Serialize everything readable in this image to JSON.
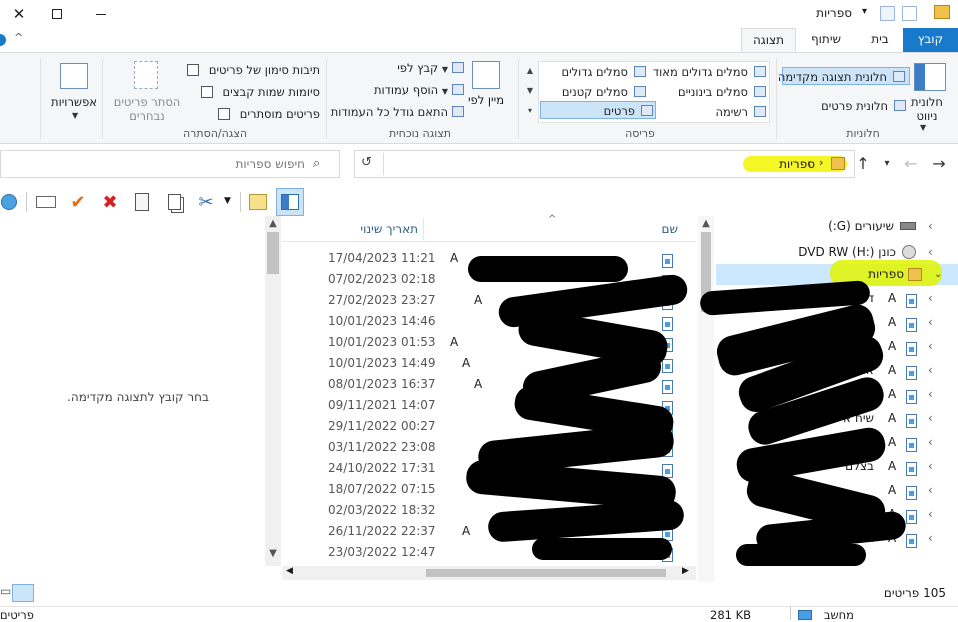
{
  "window": {
    "title": "ספריות",
    "minimize_icon": "minimize-icon",
    "maximize_icon": "maximize-icon",
    "close_icon": "close-icon"
  },
  "tabs": [
    {
      "label": "קובץ",
      "active": false,
      "file": true
    },
    {
      "label": "בית",
      "active": false
    },
    {
      "label": "שיתוף",
      "active": false
    },
    {
      "label": "תצוגה",
      "active": true
    }
  ],
  "ribbon": {
    "panes": {
      "label": "חלוניות",
      "nav_pane": "חלונית ניווט",
      "preview_pane": "חלונית תצוגה מקדימה",
      "details_pane": "חלונית פרטים"
    },
    "layout": {
      "label": "פריסה",
      "items": [
        "סמלים גדולים מאוד",
        "סמלים גדולים",
        "סמלים בינוניים",
        "סמלים קטנים",
        "רשימה",
        "פרטים"
      ],
      "selected": "פרטים"
    },
    "current_view": {
      "label": "תצוגה נוכחית",
      "sort_by": "מיין לפי",
      "group_by": "קבץ לפי",
      "add_columns": "הוסף עמודות",
      "size_all_columns": "התאם גודל כל העמודות"
    },
    "show_hide": {
      "label": "הצגה/הסתרה",
      "item_checkboxes": "תיבות סימון של פריטים",
      "file_name_extensions": "סיומות שמות קבצים",
      "hidden_items": "פריטים מוסתרים",
      "hide_selected": "הסתר פריטים נבחרים",
      "options": "אפשרויות"
    }
  },
  "address": {
    "path": "ספריות",
    "search_placeholder": "חיפוש ספריות"
  },
  "columns": {
    "name": "שם",
    "date_modified": "תאריך שינוי"
  },
  "files": [
    {
      "date": "17/04/2023 11:21",
      "attr": "A"
    },
    {
      "date": "07/02/2023 02:18",
      "attr": ""
    },
    {
      "date": "27/02/2023 23:27",
      "attr": "A"
    },
    {
      "date": "10/01/2023 14:46",
      "attr": ""
    },
    {
      "date": "10/01/2023 01:53",
      "attr": "A"
    },
    {
      "date": "10/01/2023 14:49",
      "attr": "A"
    },
    {
      "date": "08/01/2023 16:37",
      "attr": "A"
    },
    {
      "date": "09/11/2021 14:07",
      "attr": ""
    },
    {
      "date": "29/11/2022 00:27",
      "attr": ""
    },
    {
      "date": "03/11/2022 23:08",
      "attr": ""
    },
    {
      "date": "24/10/2022 17:31",
      "attr": ""
    },
    {
      "date": "18/07/2022 07:15",
      "attr": ""
    },
    {
      "date": "02/03/2022 18:32",
      "attr": ""
    },
    {
      "date": "26/11/2022 22:37",
      "attr": "A"
    },
    {
      "date": "23/03/2022 12:47",
      "attr": ""
    }
  ],
  "nav": {
    "drive_g": "שיעורים (G:)",
    "drive_h": "כונן DVD RW (H:)",
    "libraries": "ספריות",
    "children": [
      {
        "attr": "A",
        "label": "דמ"
      },
      {
        "attr": "A",
        "label": ""
      },
      {
        "attr": "A",
        "label": "פורים פג"
      },
      {
        "attr": "A",
        "label": "אלבומ"
      },
      {
        "attr": "A",
        "label": "ות"
      },
      {
        "attr": "A",
        "label": "שיח איש"
      },
      {
        "attr": "A",
        "label": "אלי זינ"
      },
      {
        "attr": "A",
        "label": "בצלם"
      },
      {
        "attr": "A",
        "label": ""
      },
      {
        "attr": "A",
        "label": ""
      },
      {
        "attr": "A",
        "label": "ח"
      }
    ]
  },
  "preview": {
    "message": "בחר קובץ לתצוגה מקדימה."
  },
  "status": {
    "item_count": "105 פריטים",
    "size": "281 KB",
    "location": "מחשב",
    "items_word": "פריטים"
  }
}
